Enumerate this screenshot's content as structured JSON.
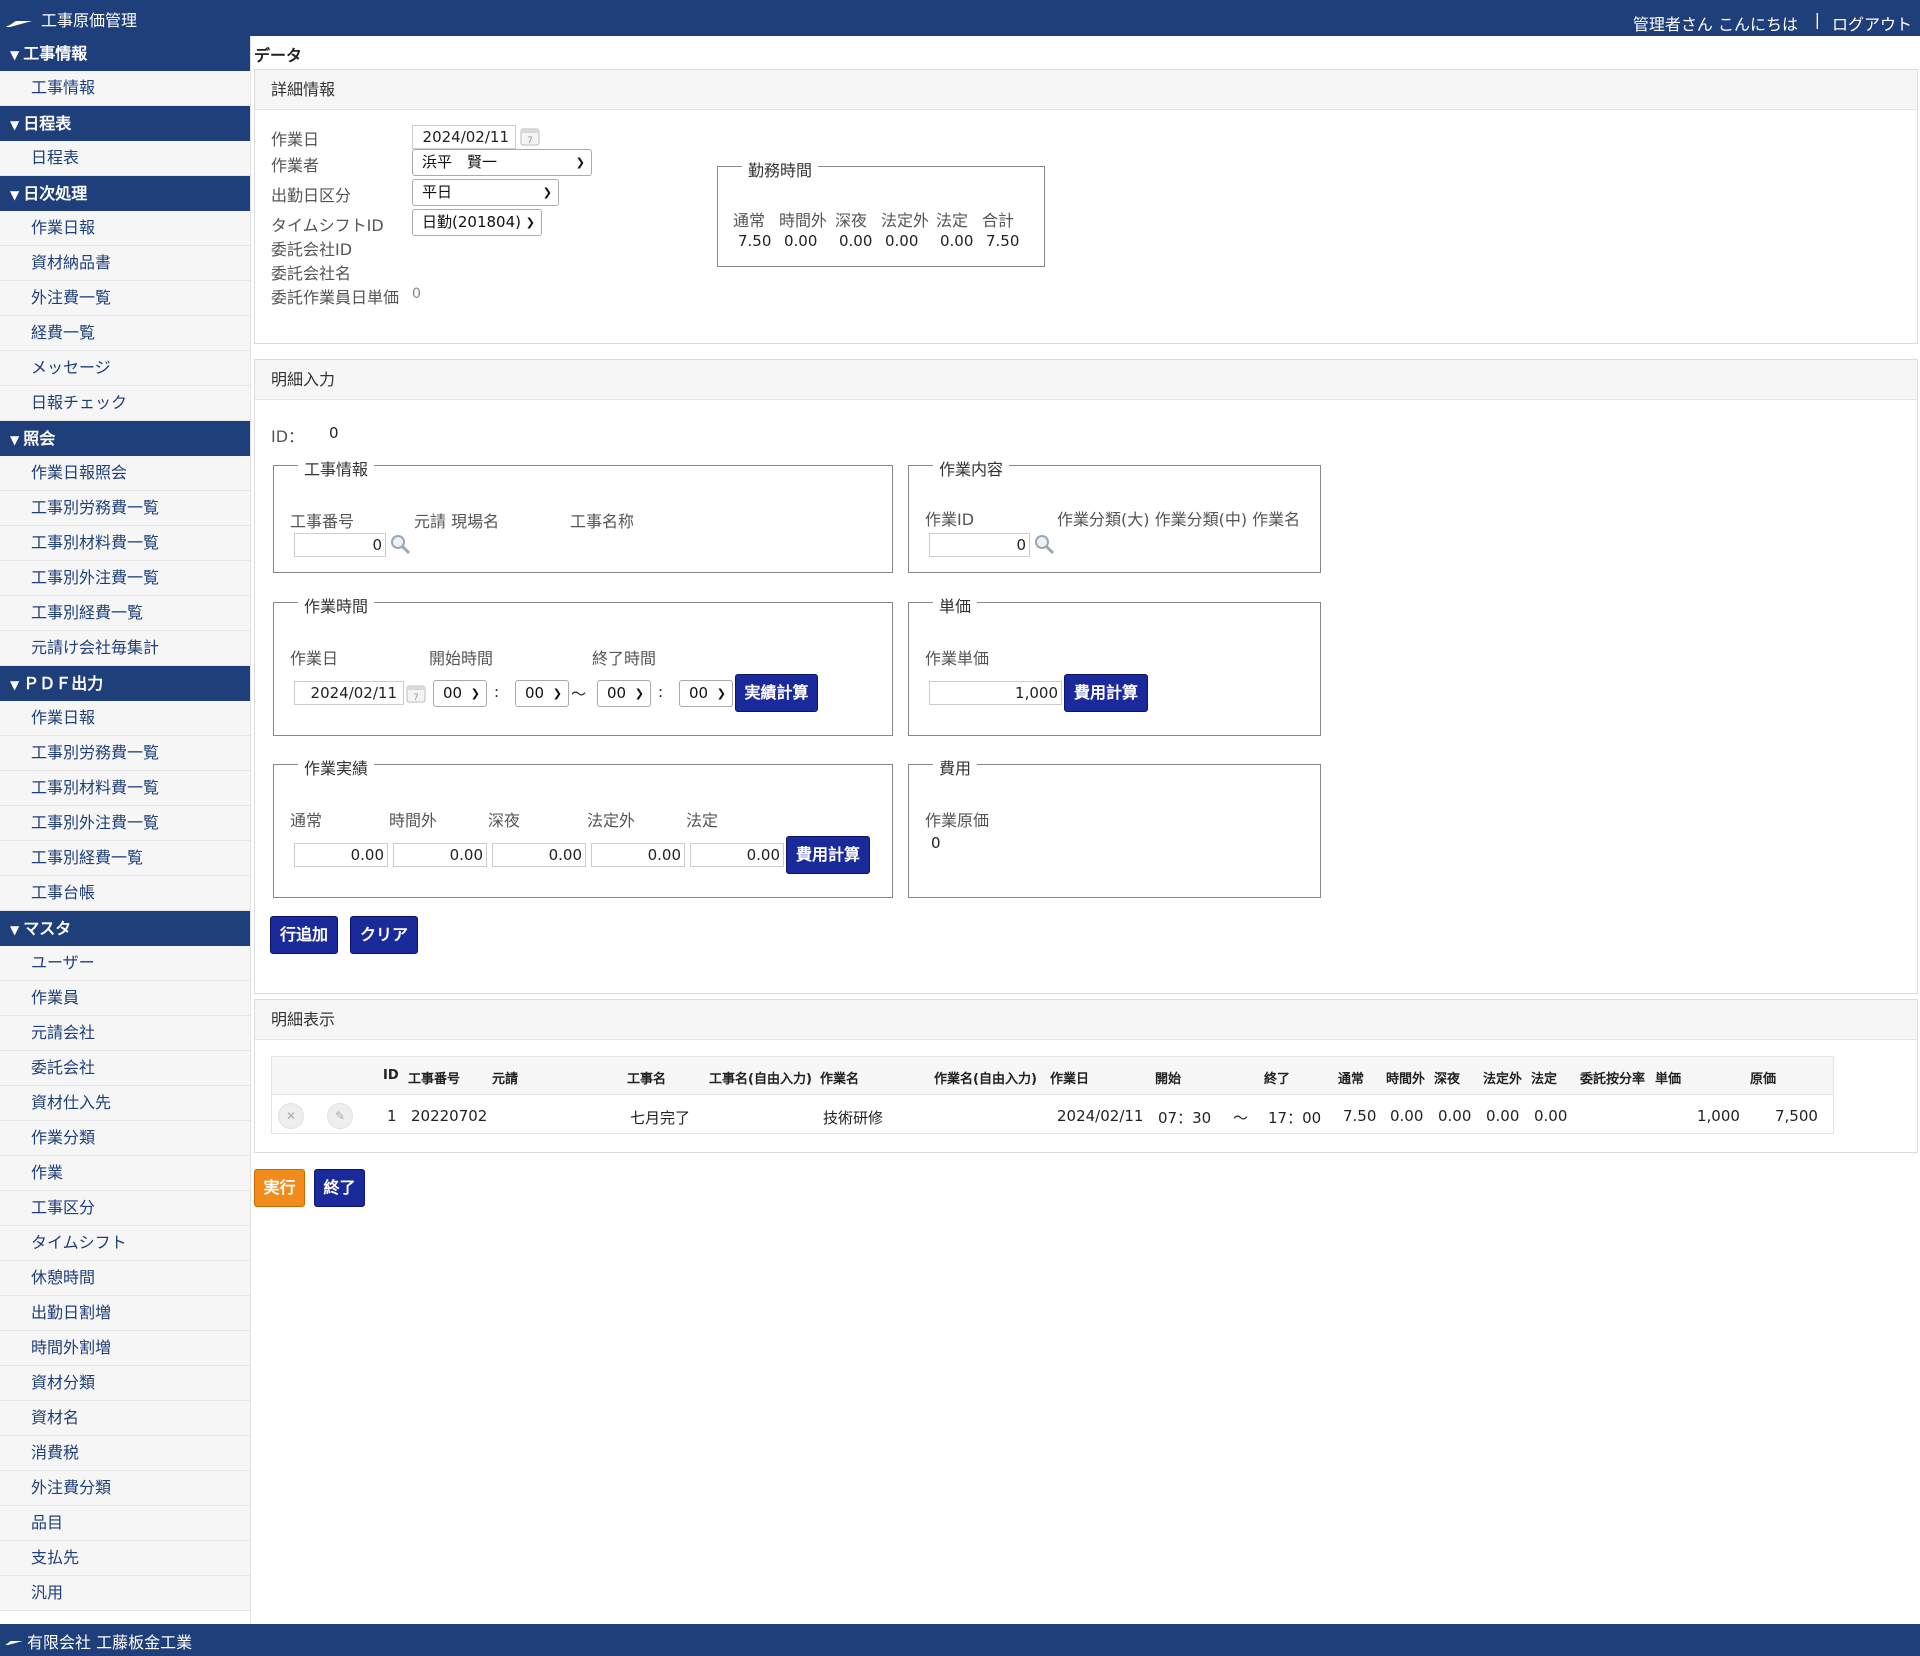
{
  "header": {
    "app_title": "工事原価管理",
    "greeting": "管理者さん こんにちは",
    "separator": "|",
    "logout": "ログアウト"
  },
  "sidebar": {
    "sections": [
      {
        "title": "工事情報",
        "items": [
          "工事情報"
        ]
      },
      {
        "title": "日程表",
        "items": [
          "日程表"
        ]
      },
      {
        "title": "日次処理",
        "items": [
          "作業日報",
          "資材納品書",
          "外注費一覧",
          "経費一覧",
          "メッセージ",
          "日報チェック"
        ]
      },
      {
        "title": "照会",
        "items": [
          "作業日報照会",
          "工事別労務費一覧",
          "工事別材料費一覧",
          "工事別外注費一覧",
          "工事別経費一覧",
          "元請け会社毎集計"
        ]
      },
      {
        "title": "ＰＤＦ出力",
        "items": [
          "作業日報",
          "工事別労務費一覧",
          "工事別材料費一覧",
          "工事別外注費一覧",
          "工事別経費一覧",
          "工事台帳"
        ]
      },
      {
        "title": "マスタ",
        "items": [
          "ユーザー",
          "作業員",
          "元請会社",
          "委託会社",
          "資材仕入先",
          "作業分類",
          "作業",
          "工事区分",
          "タイムシフト",
          "休憩時間",
          "出勤日割増",
          "時間外割増",
          "資材分類",
          "資材名",
          "消費税",
          "外注費分類",
          "品目",
          "支払先",
          "汎用"
        ]
      }
    ]
  },
  "page_title": "データ",
  "detail": {
    "heading": "詳細情報",
    "labels": {
      "work_date": "作業日",
      "worker": "作業者",
      "attendance_type": "出勤日区分",
      "timeshift_id": "タイムシフトID",
      "contractor_id": "委託会社ID",
      "contractor_name": "委託会社名",
      "contract_unit_price": "委託作業員日単価"
    },
    "values": {
      "work_date": "2024/02/11",
      "worker": "浜平　賢一",
      "attendance_type": "平日",
      "timeshift_id": "日勤(201804)",
      "contract_unit_price": "0"
    },
    "work_hours": {
      "legend": "勤務時間",
      "headers": [
        "通常",
        "時間外",
        "深夜",
        "法定外",
        "法定",
        "合計"
      ],
      "values": [
        "7.50",
        "0.00",
        "0.00",
        "0.00",
        "0.00",
        "7.50"
      ]
    }
  },
  "entry": {
    "heading": "明細入力",
    "id_label": "ID：",
    "id_value": "0",
    "kouji": {
      "legend": "工事情報",
      "labels": [
        "工事番号",
        "元請 現場名",
        "工事名称"
      ],
      "number_value": "0"
    },
    "sagyou": {
      "legend": "作業内容",
      "labels": [
        "作業ID",
        "作業分類(大) 作業分類(中) 作業名"
      ],
      "id_value": "0"
    },
    "jikan": {
      "legend": "作業時間",
      "labels": [
        "作業日",
        "開始時間",
        "終了時間"
      ],
      "date_value": "2024/02/11",
      "start_h": "00",
      "start_m": "00",
      "end_h": "00",
      "end_m": "00",
      "colon": ":",
      "tilde": "〜",
      "button": "実績計算"
    },
    "tanka": {
      "legend": "単価",
      "label": "作業単価",
      "value": "1,000",
      "button": "費用計算"
    },
    "jisseki": {
      "legend": "作業実績",
      "labels": [
        "通常",
        "時間外",
        "深夜",
        "法定外",
        "法定"
      ],
      "values": [
        "0.00",
        "0.00",
        "0.00",
        "0.00",
        "0.00"
      ],
      "button": "費用計算"
    },
    "hiyou": {
      "legend": "費用",
      "label": "作業原価",
      "value": "0"
    },
    "buttons": {
      "add_row": "行追加",
      "clear": "クリア"
    }
  },
  "list": {
    "heading": "明細表示",
    "columns": [
      "ID",
      "工事番号",
      "元請",
      "工事名",
      "工事名(自由入力)",
      "作業名",
      "作業名(自由入力)",
      "作業日",
      "開始",
      "終了",
      "通常",
      "時間外",
      "深夜",
      "法定外",
      "法定",
      "委託按分率",
      "単価",
      "原価"
    ],
    "rows": [
      {
        "id": "1",
        "kouji_no": "20220702",
        "motouke": "",
        "kouji_name": "七月完了",
        "kouji_free": "",
        "sagyou_name": "技術研修",
        "sagyou_free": "",
        "date": "2024/02/11",
        "start": "07：30",
        "tilde": "〜",
        "end": "17：00",
        "normal": "7.50",
        "overtime": "0.00",
        "night": "0.00",
        "extra_legal": "0.00",
        "legal": "0.00",
        "ratio": "",
        "unit": "1,000",
        "cost": "7,500"
      }
    ]
  },
  "actions": {
    "execute": "実行",
    "finish": "終了"
  },
  "footer": {
    "company": "有限会社 工藤板金工業"
  },
  "colors": {
    "navy": "#1f3f7a",
    "button_blue": "#1b2a9b",
    "button_orange": "#f28b1a"
  }
}
